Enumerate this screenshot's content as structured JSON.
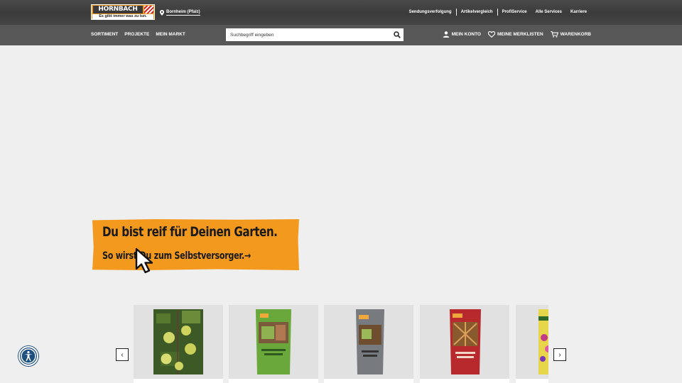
{
  "header": {
    "logo": {
      "brand": "HORNBACH",
      "slogan": "Es gibt immer was zu tun."
    },
    "store": "Bornheim (Pfalz)",
    "links": [
      "Sendungsverfolgung",
      "Artikelvergleich",
      "ProfiService",
      "Alle Services",
      "Karriere"
    ]
  },
  "nav": {
    "main": [
      "SORTIMENT",
      "PROJEKTE",
      "MEIN MARKT"
    ],
    "search_placeholder": "Suchbegriff eingeben",
    "user": {
      "account": "MEIN KONTO",
      "wishlist": "MEINE MERKLISTEN",
      "cart": "WARENKORB"
    }
  },
  "hero": {
    "headline": "Du bist reif für Deinen Garten.",
    "cta": "So wirst Du zum Selbstversorger.→"
  },
  "carousel": {
    "prev_label": "‹",
    "next_label": "›"
  },
  "colors": {
    "accent": "#f39a1e",
    "topbar": "#404040",
    "navbar": "#575757",
    "background": "#efefef"
  }
}
